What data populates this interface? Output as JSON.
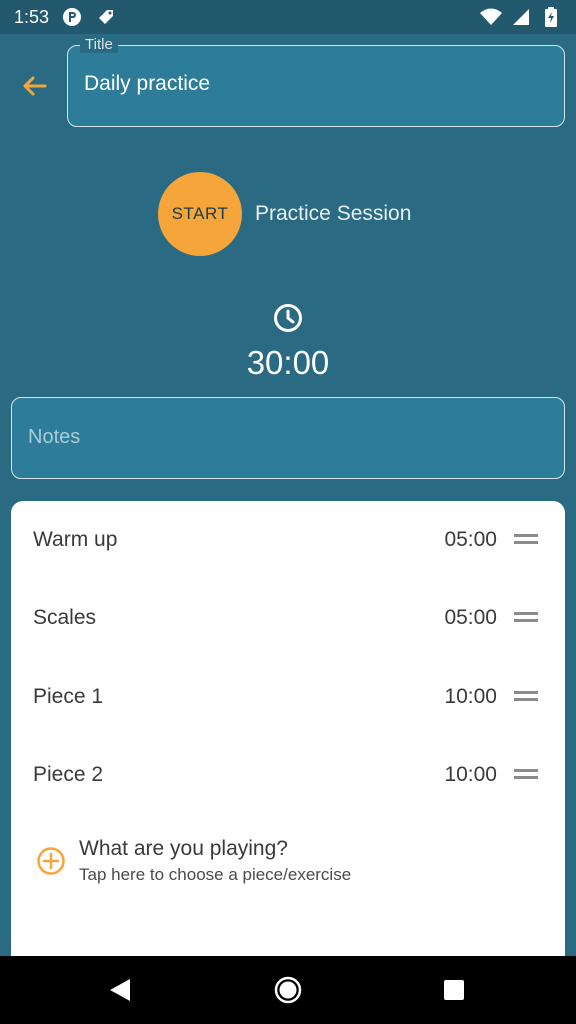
{
  "status_bar": {
    "time": "1:53",
    "icons": [
      "notification-p-icon",
      "notification-tag-icon",
      "wifi-icon",
      "signal-icon",
      "battery-icon"
    ]
  },
  "header": {
    "back_icon": "arrow-left-icon",
    "title_label": "Title",
    "title_value": "Daily practice"
  },
  "session": {
    "start_label": "START",
    "session_label": "Practice Session",
    "clock_icon": "clock-icon",
    "total_time": "30:00"
  },
  "notes": {
    "placeholder": "Notes"
  },
  "items": [
    {
      "name": "Warm up",
      "duration": "05:00"
    },
    {
      "name": "Scales",
      "duration": "05:00"
    },
    {
      "name": "Piece 1",
      "duration": "10:00"
    },
    {
      "name": "Piece 2",
      "duration": "10:00"
    }
  ],
  "add_item": {
    "icon": "add-circle-icon",
    "title": "What are you playing?",
    "subtitle": "Tap here to choose a piece/exercise"
  },
  "nav": {
    "back_icon": "nav-back-icon",
    "home_icon": "nav-home-icon",
    "recents_icon": "nav-recents-icon"
  },
  "colors": {
    "background": "#2a6a82",
    "accent": "#f6a53a",
    "field": "#2d7d9a",
    "card": "#ffffff"
  }
}
